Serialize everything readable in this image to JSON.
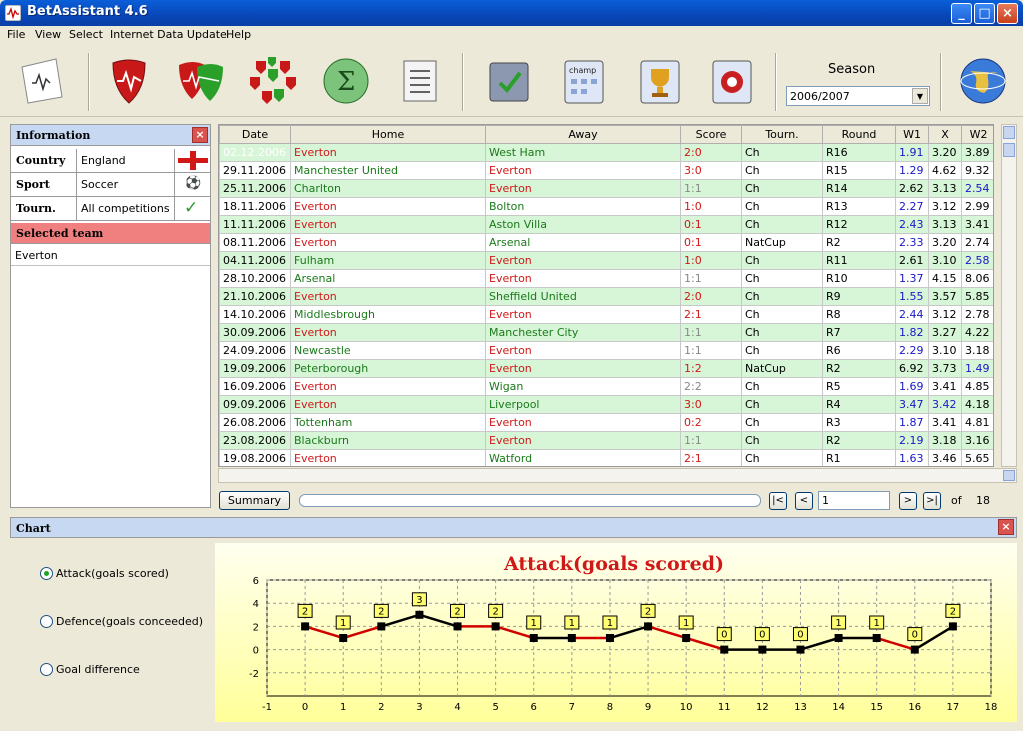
{
  "window": {
    "title": "BetAssistant 4.6",
    "minimize": "_",
    "maximize": "□",
    "close": "×"
  },
  "menu": [
    "File",
    "View",
    "Select",
    "Internet Data Update",
    "Help"
  ],
  "toolbar": {
    "season_label": "Season",
    "season_value": "2006/2007",
    "season_arrow": "▼",
    "champ_label": "champ"
  },
  "info": {
    "header": "Information",
    "close": "×",
    "rows": [
      {
        "key": "Country",
        "value": "England"
      },
      {
        "key": "Sport",
        "value": "Soccer"
      },
      {
        "key": "Tourn.",
        "value": "All competitions"
      }
    ],
    "selected_header": "Selected team",
    "selected_team": "Everton",
    "tick": "✓",
    "ball": "⚽"
  },
  "table": {
    "columns": [
      "Date",
      "Home",
      "Away",
      "Score",
      "Tourn.",
      "Round",
      "W1",
      "X",
      "W2"
    ],
    "rows": [
      {
        "date": "02.12.2006",
        "home": "Everton",
        "away": "West Ham",
        "score": "2:0",
        "tourn": "Ch",
        "round": "R16",
        "w1": "1.91",
        "x": "3.20",
        "w2": "3.89"
      },
      {
        "date": "29.11.2006",
        "home": "Manchester United",
        "away": "Everton",
        "score": "3:0",
        "tourn": "Ch",
        "round": "R15",
        "w1": "1.29",
        "x": "4.62",
        "w2": "9.32"
      },
      {
        "date": "25.11.2006",
        "home": "Charlton",
        "away": "Everton",
        "score": "1:1",
        "tourn": "Ch",
        "round": "R14",
        "w1": "2.62",
        "x": "3.13",
        "w2": "2.54"
      },
      {
        "date": "18.11.2006",
        "home": "Everton",
        "away": "Bolton",
        "score": "1:0",
        "tourn": "Ch",
        "round": "R13",
        "w1": "2.27",
        "x": "3.12",
        "w2": "2.99"
      },
      {
        "date": "11.11.2006",
        "home": "Everton",
        "away": "Aston Villa",
        "score": "0:1",
        "tourn": "Ch",
        "round": "R12",
        "w1": "2.43",
        "x": "3.13",
        "w2": "3.41"
      },
      {
        "date": "08.11.2006",
        "home": "Everton",
        "away": "Arsenal",
        "score": "0:1",
        "tourn": "NatCup",
        "round": "R2",
        "w1": "2.33",
        "x": "3.20",
        "w2": "2.74"
      },
      {
        "date": "04.11.2006",
        "home": "Fulham",
        "away": "Everton",
        "score": "1:0",
        "tourn": "Ch",
        "round": "R11",
        "w1": "2.61",
        "x": "3.10",
        "w2": "2.58"
      },
      {
        "date": "28.10.2006",
        "home": "Arsenal",
        "away": "Everton",
        "score": "1:1",
        "tourn": "Ch",
        "round": "R10",
        "w1": "1.37",
        "x": "4.15",
        "w2": "8.06"
      },
      {
        "date": "21.10.2006",
        "home": "Everton",
        "away": "Sheffield United",
        "score": "2:0",
        "tourn": "Ch",
        "round": "R9",
        "w1": "1.55",
        "x": "3.57",
        "w2": "5.85"
      },
      {
        "date": "14.10.2006",
        "home": "Middlesbrough",
        "away": "Everton",
        "score": "2:1",
        "tourn": "Ch",
        "round": "R8",
        "w1": "2.44",
        "x": "3.12",
        "w2": "2.78"
      },
      {
        "date": "30.09.2006",
        "home": "Everton",
        "away": "Manchester City",
        "score": "1:1",
        "tourn": "Ch",
        "round": "R7",
        "w1": "1.82",
        "x": "3.27",
        "w2": "4.22"
      },
      {
        "date": "24.09.2006",
        "home": "Newcastle",
        "away": "Everton",
        "score": "1:1",
        "tourn": "Ch",
        "round": "R6",
        "w1": "2.29",
        "x": "3.10",
        "w2": "3.18"
      },
      {
        "date": "19.09.2006",
        "home": "Peterborough",
        "away": "Everton",
        "score": "1:2",
        "tourn": "NatCup",
        "round": "R2",
        "w1": "6.92",
        "x": "3.73",
        "w2": "1.49"
      },
      {
        "date": "16.09.2006",
        "home": "Everton",
        "away": "Wigan",
        "score": "2:2",
        "tourn": "Ch",
        "round": "R5",
        "w1": "1.69",
        "x": "3.41",
        "w2": "4.85"
      },
      {
        "date": "09.09.2006",
        "home": "Everton",
        "away": "Liverpool",
        "score": "3:0",
        "tourn": "Ch",
        "round": "R4",
        "w1": "3.47",
        "x": "3.42",
        "w2": "4.18"
      },
      {
        "date": "26.08.2006",
        "home": "Tottenham",
        "away": "Everton",
        "score": "0:2",
        "tourn": "Ch",
        "round": "R3",
        "w1": "1.87",
        "x": "3.41",
        "w2": "4.81"
      },
      {
        "date": "23.08.2006",
        "home": "Blackburn",
        "away": "Everton",
        "score": "1:1",
        "tourn": "Ch",
        "round": "R2",
        "w1": "2.19",
        "x": "3.18",
        "w2": "3.16"
      },
      {
        "date": "19.08.2006",
        "home": "Everton",
        "away": "Watford",
        "score": "2:1",
        "tourn": "Ch",
        "round": "R1",
        "w1": "1.63",
        "x": "3.46",
        "w2": "5.65"
      }
    ]
  },
  "pager": {
    "summary": "Summary",
    "first": "|<",
    "prev": "<",
    "page": "1",
    "next": ">",
    "last": ">|",
    "of": "of",
    "total": "18"
  },
  "chart_panel": {
    "header": "Chart",
    "close": "×",
    "options": [
      "Attack(goals scored)",
      "Defence(goals conceeded)",
      "Goal difference"
    ]
  },
  "chart_data": {
    "type": "line",
    "title": "Attack(goals scored)",
    "xlabel": "",
    "ylabel": "",
    "xlim": [
      -1,
      18
    ],
    "ylim": [
      -4,
      6
    ],
    "x": [
      0,
      1,
      2,
      3,
      4,
      5,
      6,
      7,
      8,
      9,
      10,
      11,
      12,
      13,
      14,
      15,
      16,
      17
    ],
    "y": [
      2,
      1,
      2,
      3,
      2,
      2,
      1,
      1,
      1,
      2,
      1,
      0,
      0,
      0,
      1,
      1,
      0,
      2
    ],
    "xticks": [
      "-1",
      "0",
      "1",
      "2",
      "3",
      "4",
      "5",
      "6",
      "7",
      "8",
      "9",
      "10",
      "11",
      "12",
      "13",
      "14",
      "15",
      "16",
      "17",
      "18"
    ],
    "yticks": [
      "-2",
      "0",
      "2",
      "4",
      "6"
    ],
    "segment_colors": [
      "#d00000",
      "#d00000",
      "#000000",
      "#000000",
      "#d00000",
      "#d00000",
      "#000000",
      "#d00000",
      "#000000",
      "#d00000",
      "#d00000",
      "#000000",
      "#000000",
      "#000000",
      "#000000",
      "#d00000",
      "#000000"
    ],
    "grid": true
  }
}
